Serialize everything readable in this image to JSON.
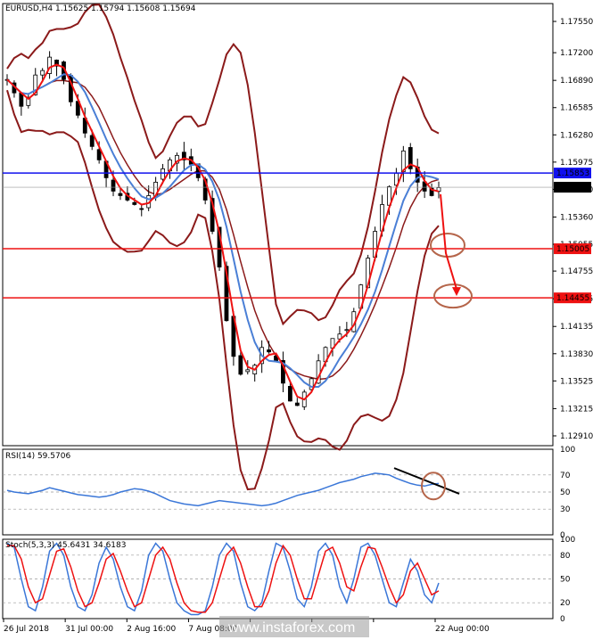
{
  "header": {
    "main_title": "EURUSD,H4  1.15625 1.15794 1.15608 1.15694",
    "rsi_title": "RSI(14) 59.5706",
    "stoch_title": "Stoch(5,3,3) 45.6431 34.6183"
  },
  "watermark": "www.instaforex.com",
  "colors": {
    "price_candle": "#1f7a1f",
    "ma_red": "#ee1111",
    "ma_blue": "#4a7fd6",
    "bollinger": "#8b1a1a",
    "level_blue": "#1010ee",
    "level_red": "#ee1111",
    "rsi_line": "#3b77d8",
    "stoch_main": "#3b77d8",
    "stoch_signal": "#ee1111",
    "annotation": "#b5654a"
  },
  "chart_data": [
    {
      "type": "candlestick",
      "title": "EURUSD,H4  1.15625 1.15794 1.15608 1.15694",
      "price_axis_ticks": [
        "1.17550",
        "1.17200",
        "1.16890",
        "1.16585",
        "1.16280",
        "1.15975",
        "1.15670",
        "1.15360",
        "1.15055",
        "1.14755",
        "1.14445",
        "1.14135",
        "1.13830",
        "1.13525",
        "1.13215",
        "1.12910"
      ],
      "ylim": [
        1.128,
        1.1775
      ],
      "time_axis_labels": [
        "26 Jul 2018",
        "31 Jul 00:00",
        "2 Aug 16:00",
        "7 Aug 08:00",
        "",
        "",
        "",
        "22 Aug 00:00"
      ],
      "current_price": "1.15694",
      "horizontal_levels": [
        {
          "value": 1.15853,
          "label": "1.15853",
          "color": "blue"
        },
        {
          "value": 1.15005,
          "label": "1.15005",
          "color": "red"
        },
        {
          "value": 1.14455,
          "label": "1.14455",
          "color": "red"
        }
      ],
      "close_path": [
        1.169,
        1.1675,
        1.166,
        1.167,
        1.1695,
        1.17,
        1.1715,
        1.1705,
        1.169,
        1.1665,
        1.165,
        1.163,
        1.1615,
        1.16,
        1.158,
        1.1565,
        1.156,
        1.1555,
        1.155,
        1.1545,
        1.156,
        1.1575,
        1.159,
        1.16,
        1.1605,
        1.16,
        1.1595,
        1.158,
        1.1555,
        1.152,
        1.148,
        1.142,
        1.138,
        1.136,
        1.1365,
        1.137,
        1.139,
        1.1385,
        1.1375,
        1.135,
        1.133,
        1.1325,
        1.134,
        1.1355,
        1.1375,
        1.139,
        1.14,
        1.1405,
        1.141,
        1.143,
        1.146,
        1.149,
        1.152,
        1.155,
        1.157,
        1.1585,
        1.161,
        1.159,
        1.1575,
        1.1565,
        1.156,
        1.1569
      ]
    },
    {
      "type": "line",
      "title": "RSI(14) 59.5706",
      "ylim": [
        0,
        100
      ],
      "y_ticks": [
        "100",
        "70",
        "50",
        "30",
        "0"
      ],
      "series": [
        {
          "name": "RSI(14)",
          "values": [
            52,
            50,
            49,
            48,
            50,
            52,
            55,
            53,
            51,
            49,
            47,
            46,
            45,
            44,
            45,
            47,
            50,
            52,
            54,
            53,
            51,
            48,
            44,
            40,
            38,
            36,
            35,
            34,
            36,
            38,
            40,
            39,
            38,
            37,
            36,
            35,
            34,
            35,
            37,
            40,
            43,
            46,
            48,
            50,
            52,
            55,
            58,
            61,
            63,
            65,
            68,
            70,
            72,
            71,
            70,
            66,
            63,
            60,
            58,
            57,
            59,
            60
          ]
        }
      ]
    },
    {
      "type": "line",
      "title": "Stoch(5,3,3) 45.6431 34.6183",
      "ylim": [
        0,
        100
      ],
      "y_ticks": [
        "100",
        "80",
        "50",
        "20",
        "0"
      ],
      "series": [
        {
          "name": "Main",
          "values": [
            95,
            90,
            50,
            15,
            10,
            40,
            85,
            95,
            80,
            40,
            15,
            10,
            30,
            70,
            90,
            75,
            40,
            15,
            10,
            35,
            80,
            95,
            85,
            50,
            20,
            10,
            5,
            5,
            10,
            40,
            80,
            95,
            85,
            45,
            15,
            10,
            20,
            60,
            95,
            90,
            60,
            25,
            15,
            40,
            85,
            95,
            80,
            40,
            20,
            50,
            90,
            95,
            80,
            50,
            20,
            15,
            45,
            75,
            60,
            30,
            20,
            45
          ]
        },
        {
          "name": "Signal",
          "values": [
            92,
            92,
            75,
            40,
            20,
            25,
            55,
            85,
            88,
            65,
            35,
            15,
            20,
            45,
            75,
            82,
            60,
            35,
            15,
            20,
            50,
            80,
            90,
            75,
            45,
            20,
            10,
            8,
            8,
            20,
            50,
            80,
            90,
            70,
            40,
            15,
            15,
            35,
            70,
            92,
            80,
            50,
            25,
            25,
            55,
            85,
            90,
            70,
            40,
            35,
            65,
            90,
            88,
            65,
            40,
            20,
            30,
            60,
            70,
            50,
            30,
            35
          ]
        }
      ]
    }
  ]
}
